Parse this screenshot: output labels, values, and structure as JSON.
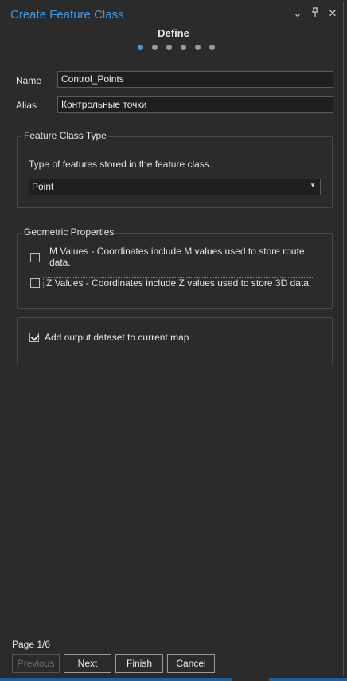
{
  "window": {
    "title": "Create Feature Class",
    "icons": [
      "chevron-down-icon",
      "pin-icon",
      "close-icon"
    ]
  },
  "wizard": {
    "step_title": "Define",
    "total_steps": 6,
    "current_step": 1
  },
  "fields": {
    "name_label": "Name",
    "name_value": "Control_Points",
    "alias_label": "Alias",
    "alias_value": "Контрольные точки"
  },
  "feature_class_type": {
    "group_title": "Feature Class Type",
    "description": "Type of features stored in the feature class.",
    "selected": "Point"
  },
  "geometric_properties": {
    "group_title": "Geometric Properties",
    "m_values_label_line1": "M Values - Coordinates include M values used to store route",
    "m_values_label_line2": "data.",
    "m_values_checked": false,
    "z_values_label": "Z Values - Coordinates include Z values used to store 3D data.",
    "z_values_checked": false
  },
  "output": {
    "add_to_map_label": "Add output dataset to current map",
    "add_to_map_checked": true
  },
  "footer": {
    "page_indicator": "Page 1/6",
    "previous_label": "Previous",
    "next_label": "Next",
    "finish_label": "Finish",
    "cancel_label": "Cancel"
  },
  "colors": {
    "accent": "#3a9ae8",
    "background": "#2b2b2b",
    "border": "#1b5fa7"
  }
}
